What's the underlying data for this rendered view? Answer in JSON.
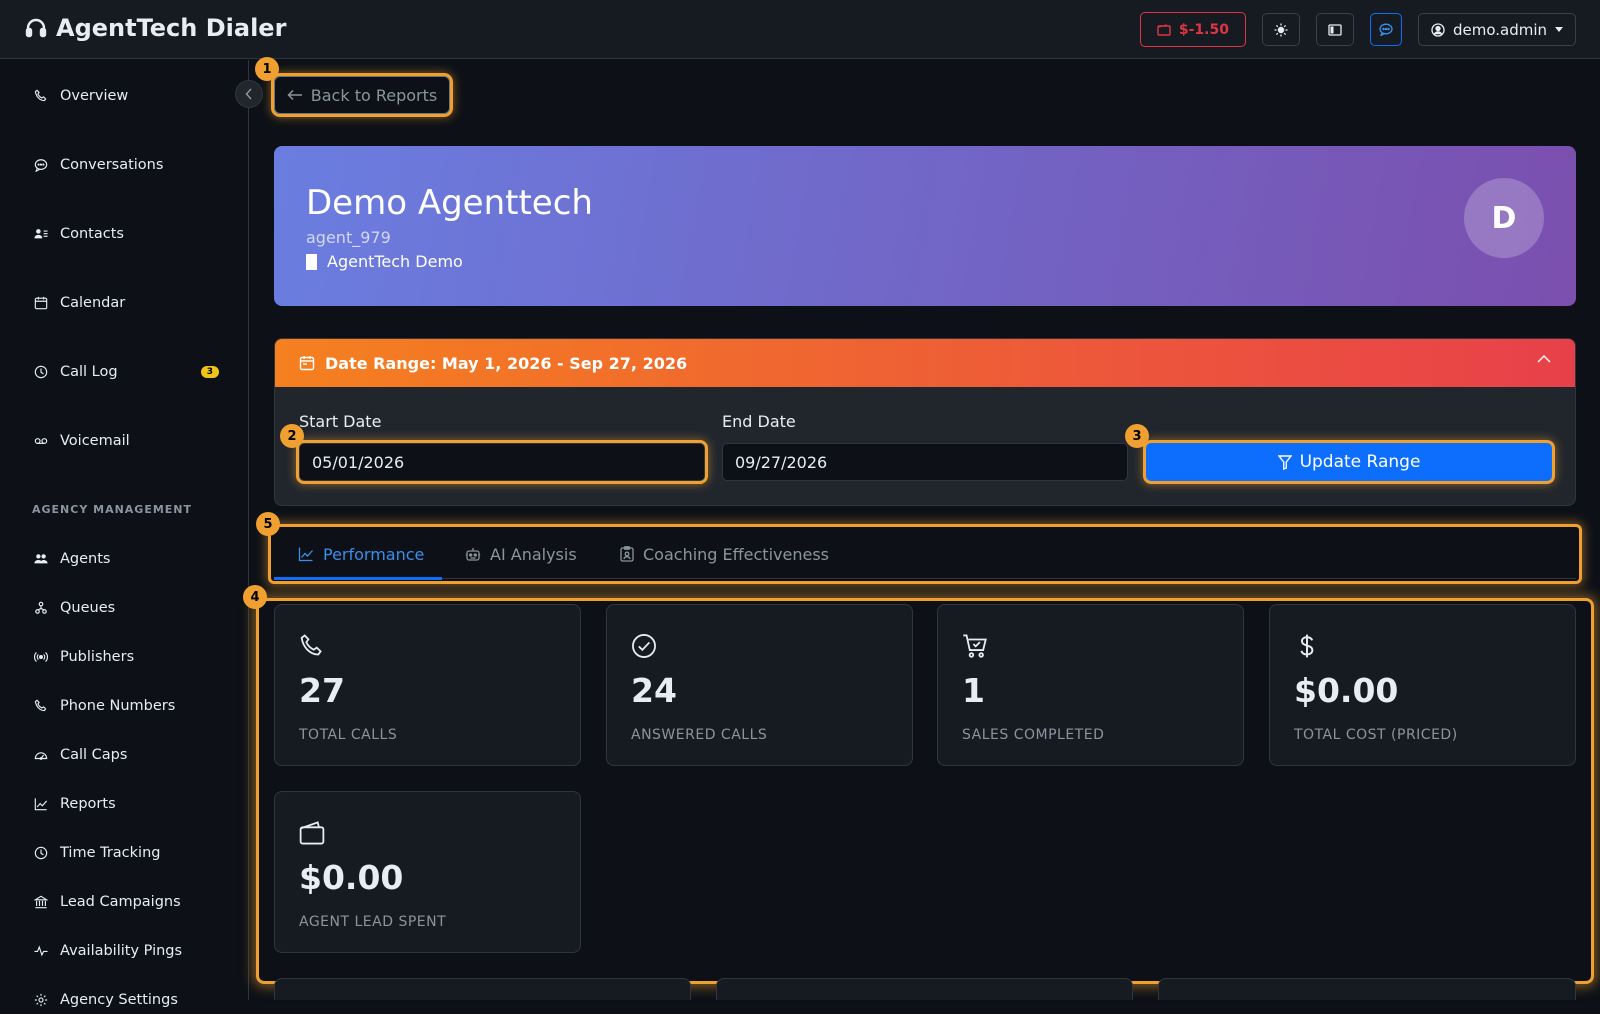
{
  "app": {
    "title": "AgentTech Dialer"
  },
  "header": {
    "balance": "$-1.50",
    "user": "demo.admin"
  },
  "sidebar": {
    "items": [
      {
        "label": "Overview"
      },
      {
        "label": "Conversations"
      },
      {
        "label": "Contacts"
      },
      {
        "label": "Calendar"
      },
      {
        "label": "Call Log",
        "badge": "3"
      },
      {
        "label": "Voicemail"
      }
    ],
    "section_title": "AGENCY MANAGEMENT",
    "management_items": [
      {
        "label": "Agents"
      },
      {
        "label": "Queues"
      },
      {
        "label": "Publishers"
      },
      {
        "label": "Phone Numbers"
      },
      {
        "label": "Call Caps"
      },
      {
        "label": "Reports"
      },
      {
        "label": "Time Tracking"
      },
      {
        "label": "Lead Campaigns"
      },
      {
        "label": "Availability Pings"
      },
      {
        "label": "Agency Settings"
      }
    ]
  },
  "markers": [
    "1",
    "2",
    "3",
    "4",
    "5"
  ],
  "main": {
    "back_label": "Back to Reports",
    "profile": {
      "name": "Demo Agenttech",
      "id": "agent_979",
      "org": "AgentTech Demo",
      "avatar": "D"
    },
    "date_range": {
      "title": "Date Range: May 1, 2026 - Sep 27, 2026",
      "start_label": "Start Date",
      "start_value": "05/01/2026",
      "end_label": "End Date",
      "end_value": "09/27/2026",
      "update_label": "Update Range"
    },
    "tabs": [
      {
        "label": "Performance",
        "active": true
      },
      {
        "label": "AI Analysis"
      },
      {
        "label": "Coaching Effectiveness"
      }
    ],
    "stats": [
      {
        "value": "27",
        "label": "TOTAL CALLS",
        "icon": "phone-icon"
      },
      {
        "value": "24",
        "label": "ANSWERED CALLS",
        "icon": "check-circle-icon"
      },
      {
        "value": "1",
        "label": "SALES COMPLETED",
        "icon": "cart-check-icon"
      },
      {
        "value": "$0.00",
        "label": "TOTAL COST (PRICED)",
        "icon": "dollar-icon"
      },
      {
        "value": "$0.00",
        "label": "AGENT LEAD SPENT",
        "icon": "wallet-icon"
      }
    ]
  },
  "colors": {
    "accent": "#0d6efd",
    "highlight": "#f0a030",
    "danger": "#dc3545",
    "badge": "#f0c419"
  }
}
